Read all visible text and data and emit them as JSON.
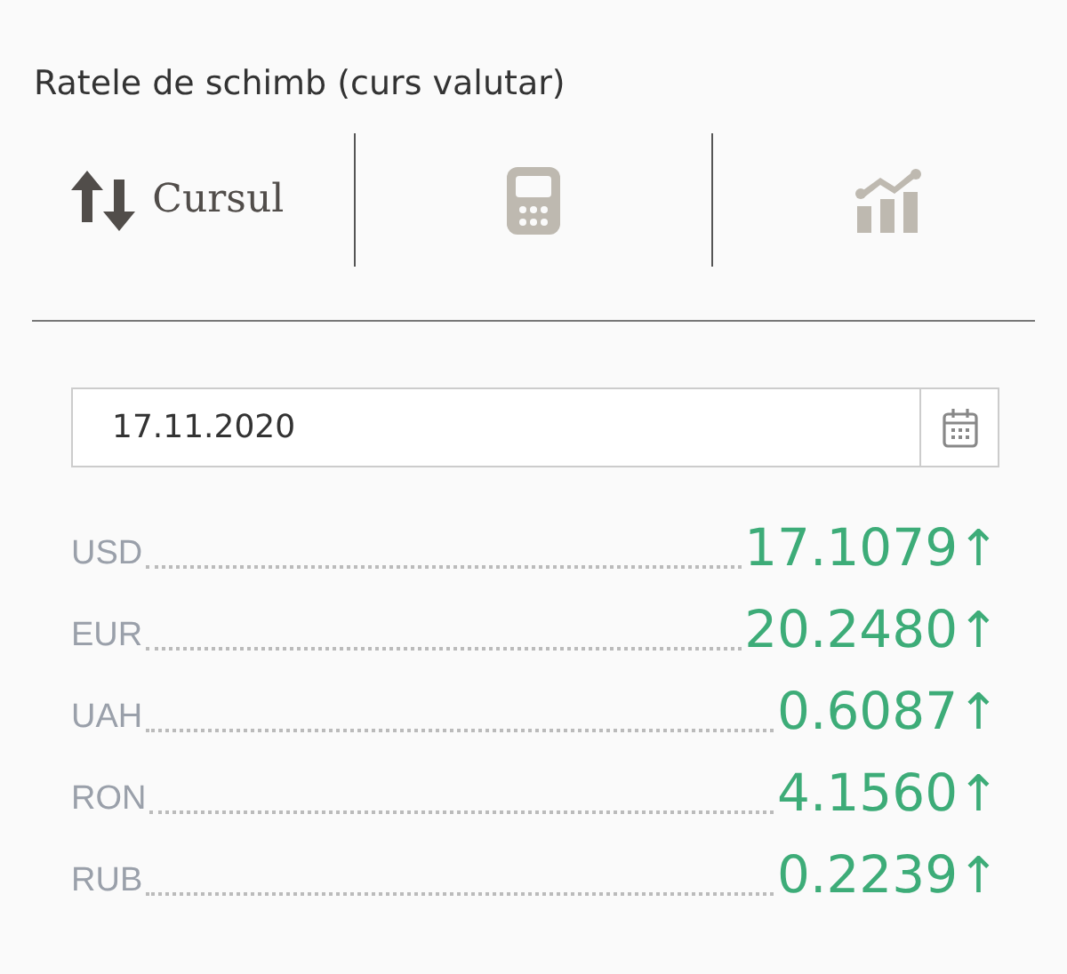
{
  "title": "Ratele de schimb (curs valutar)",
  "tabs": [
    {
      "kind": "rate",
      "label": "Cursul",
      "selected": true
    },
    {
      "kind": "calculator",
      "selected": false
    },
    {
      "kind": "chart",
      "selected": false
    }
  ],
  "date_field": {
    "value": "17.11.2020"
  },
  "rates": [
    {
      "code": "USD",
      "value": "17.1079",
      "arrow": "↑"
    },
    {
      "code": "EUR",
      "value": "20.2480",
      "arrow": "↑"
    },
    {
      "code": "UAH",
      "value": "0.6087",
      "arrow": "↑"
    },
    {
      "code": "RON",
      "value": "4.1560",
      "arrow": "↑"
    },
    {
      "code": "RUB",
      "value": "0.2239",
      "arrow": "↑"
    }
  ]
}
